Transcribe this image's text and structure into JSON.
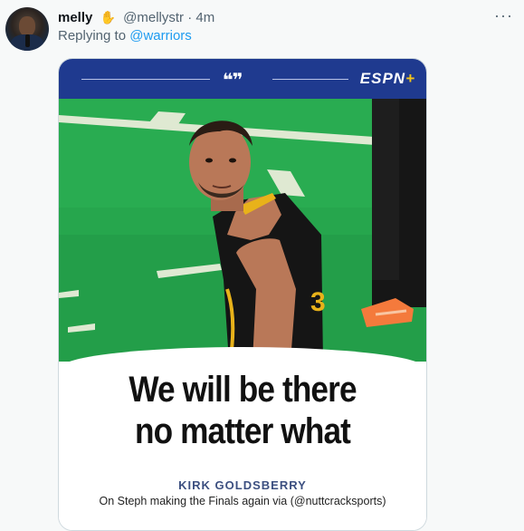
{
  "tweet": {
    "display_name": "melly",
    "handle": "@mellystr",
    "separator": "·",
    "time": "4m",
    "replying_prefix": "Replying to",
    "replying_to": "@warriors",
    "more_icon": "more-horizontal-icon",
    "badge_icon": "hamsa-hand-icon"
  },
  "media": {
    "quote_marks": "❝❞",
    "brand": "ESPN",
    "brand_plus": "+",
    "quote_line1": "We will be there",
    "quote_line2": "no matter what",
    "author": "KIRK GOLDSBERRY",
    "caption": "On Steph making the Finals again via (@nuttcracksports)",
    "jersey_number": "3"
  },
  "colors": {
    "banner": "#1f3a8f",
    "court": "#25a54c",
    "link": "#1d9bf0",
    "author": "#3c4f80"
  }
}
